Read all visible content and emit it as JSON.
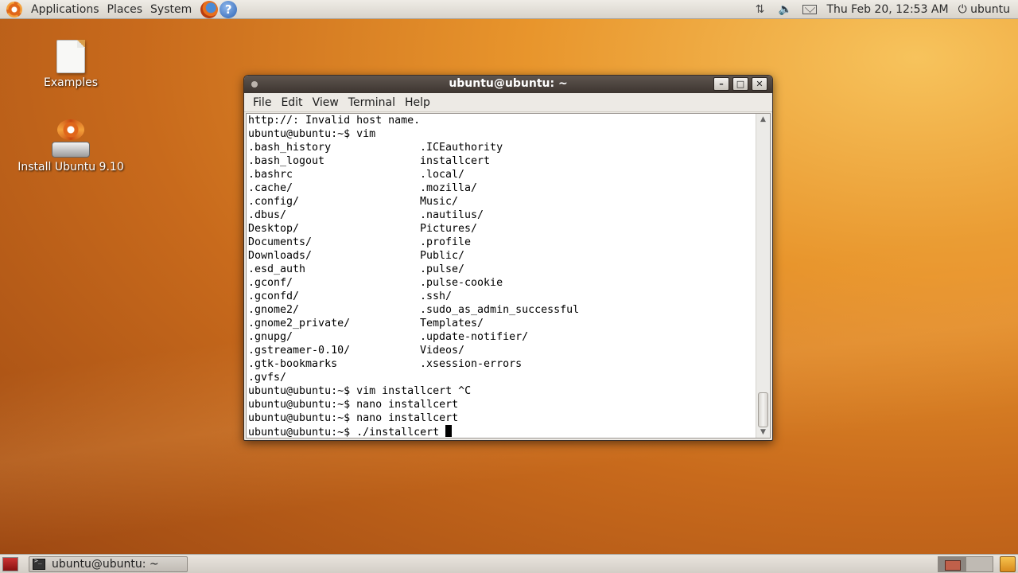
{
  "top_panel": {
    "menus": [
      "Applications",
      "Places",
      "System"
    ],
    "clock": "Thu Feb 20, 12:53 AM",
    "user": "ubuntu",
    "icons": [
      "ubuntu-logo-icon",
      "firefox-icon",
      "help-icon",
      "network-icon",
      "volume-icon",
      "mail-icon",
      "power-icon"
    ]
  },
  "desktop": {
    "icons": [
      {
        "label": "Examples",
        "icon": "folder-document-icon"
      },
      {
        "label": "Install Ubuntu 9.10",
        "icon": "installer-icon"
      }
    ]
  },
  "window": {
    "title": "ubuntu@ubuntu: ~",
    "menu": [
      "File",
      "Edit",
      "View",
      "Terminal",
      "Help"
    ],
    "buttons": [
      "minimize",
      "maximize",
      "close"
    ]
  },
  "terminal": {
    "pre_lines": [
      "http://: Invalid host name.",
      "ubuntu@ubuntu:~$ vim"
    ],
    "listing": [
      [
        ".bash_history",
        ".ICEauthority"
      ],
      [
        ".bash_logout",
        "installcert"
      ],
      [
        ".bashrc",
        ".local/"
      ],
      [
        ".cache/",
        ".mozilla/"
      ],
      [
        ".config/",
        "Music/"
      ],
      [
        ".dbus/",
        ".nautilus/"
      ],
      [
        "Desktop/",
        "Pictures/"
      ],
      [
        "Documents/",
        ".profile"
      ],
      [
        "Downloads/",
        "Public/"
      ],
      [
        ".esd_auth",
        ".pulse/"
      ],
      [
        ".gconf/",
        ".pulse-cookie"
      ],
      [
        ".gconfd/",
        ".ssh/"
      ],
      [
        ".gnome2/",
        ".sudo_as_admin_successful"
      ],
      [
        ".gnome2_private/",
        "Templates/"
      ],
      [
        ".gnupg/",
        ".update-notifier/"
      ],
      [
        ".gstreamer-0.10/",
        "Videos/"
      ],
      [
        ".gtk-bookmarks",
        ".xsession-errors"
      ],
      [
        ".gvfs/",
        ""
      ]
    ],
    "post_lines": [
      "ubuntu@ubuntu:~$ vim installcert ^C",
      "ubuntu@ubuntu:~$ nano installcert",
      "ubuntu@ubuntu:~$ nano installcert",
      "ubuntu@ubuntu:~$ ./installcert "
    ]
  },
  "bottom_panel": {
    "task": "ubuntu@ubuntu: ~",
    "workspaces": 2,
    "active_workspace": 1
  }
}
